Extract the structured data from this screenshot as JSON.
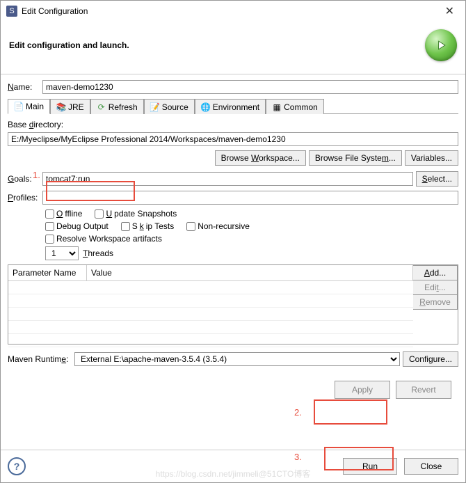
{
  "window": {
    "title": "Edit Configuration"
  },
  "header": {
    "text": "Edit configuration and launch."
  },
  "labels": {
    "name": "ame:",
    "basedir_pre": "Base ",
    "basedir_post": "irectory:",
    "goals": "oals:",
    "profiles": "rofiles:",
    "threads": "hreads"
  },
  "tabs": [
    "Main",
    "JRE",
    "Refresh",
    "Source",
    "Environment",
    "Common"
  ],
  "fields": {
    "name": "maven-demo1230",
    "basedir": "E:/Myeclipse/MyEclipse Professional 2014/Workspaces/maven-demo1230",
    "goals": "tomcat7:run",
    "profiles": "",
    "threads": "1",
    "runtime": "External E:\\apache-maven-3.5.4 (3.5.4)"
  },
  "buttons": {
    "variables": "Variables...",
    "configure": "Configure...",
    "apply": "Apply",
    "revert": "Revert",
    "run": "Run",
    "close": "Close"
  },
  "checks": {
    "offline": "ffline",
    "update": "pdate Snapshots",
    "debug": "Debug Output",
    "skip": "ip Tests",
    "nonrec": "Non-recursive",
    "resolve": "Resolve Workspace artifacts"
  },
  "table": {
    "cols": [
      "Parameter Name",
      "Value"
    ]
  },
  "annotations": [
    "1.",
    "2.",
    "3."
  ],
  "watermark": "https://blog.csdn.net/jimmeli@51CTO博客"
}
